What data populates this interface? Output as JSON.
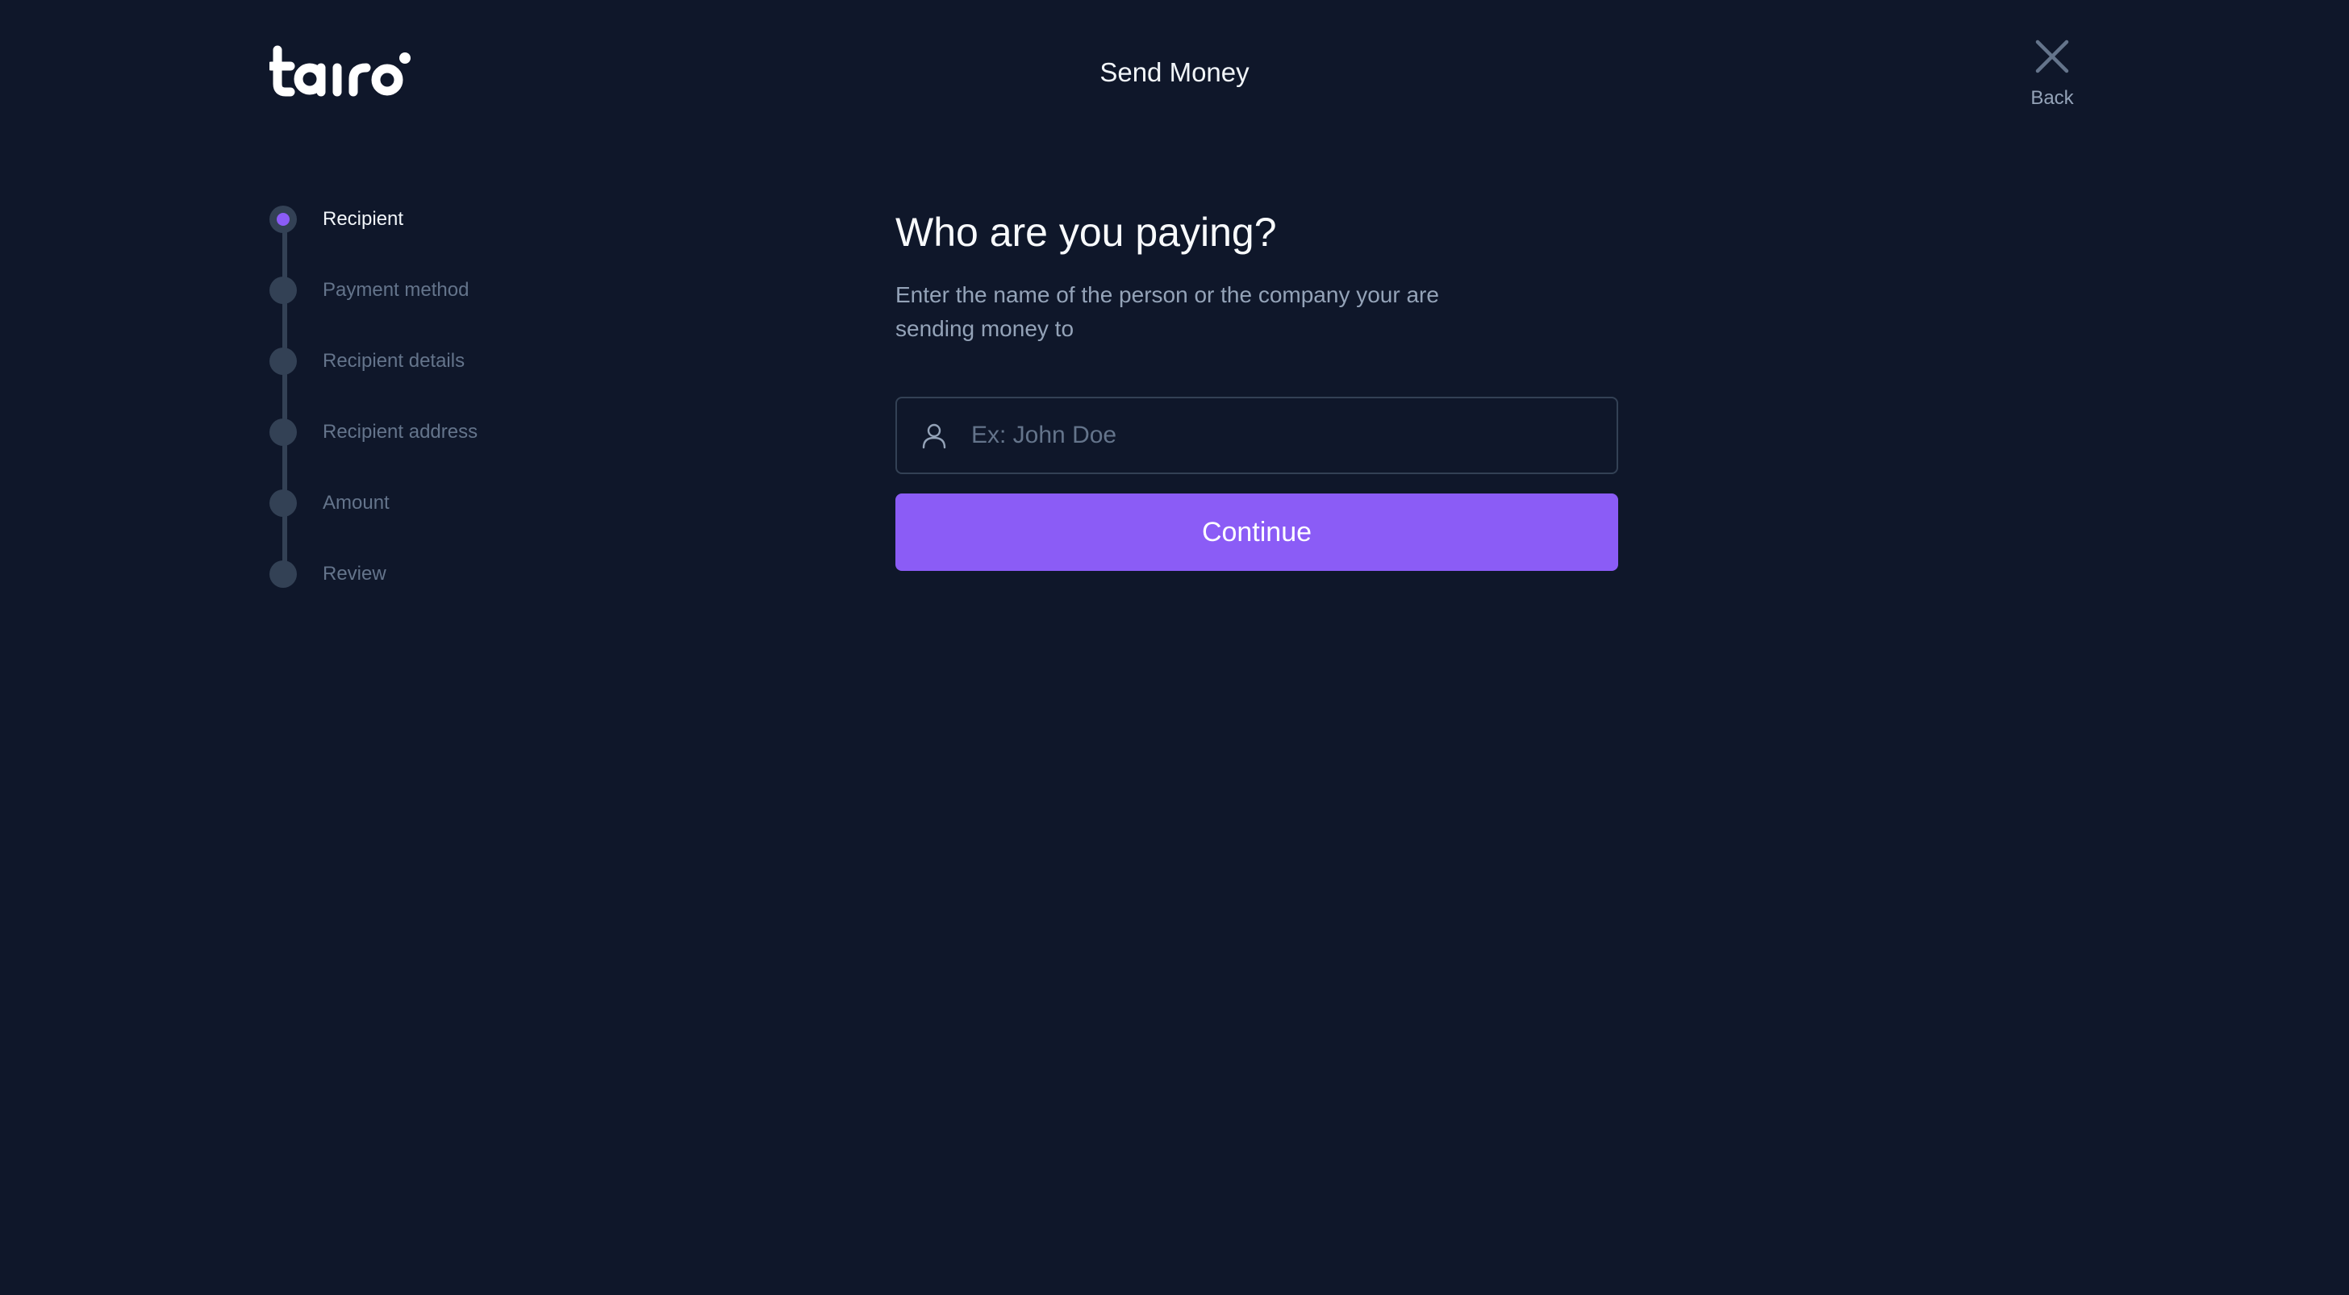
{
  "header": {
    "logo_text": "tairo",
    "title": "Send Money",
    "back_label": "Back",
    "back_icon": "close-icon"
  },
  "stepper": {
    "steps": [
      {
        "label": "Recipient",
        "active": true
      },
      {
        "label": "Payment method",
        "active": false
      },
      {
        "label": "Recipient details",
        "active": false
      },
      {
        "label": "Recipient address",
        "active": false
      },
      {
        "label": "Amount",
        "active": false
      },
      {
        "label": "Review",
        "active": false
      }
    ]
  },
  "main": {
    "heading": "Who are you paying?",
    "subtitle": "Enter the name of the person or the company your are sending money to",
    "recipient_input": {
      "placeholder": "Ex: John Doe",
      "value": "",
      "icon": "user-icon"
    },
    "continue_label": "Continue"
  },
  "colors": {
    "background": "#0f172a",
    "accent": "#8b5cf6",
    "stepper_track": "#334155",
    "muted_text": "#64748b",
    "secondary_text": "#94a3b8"
  }
}
